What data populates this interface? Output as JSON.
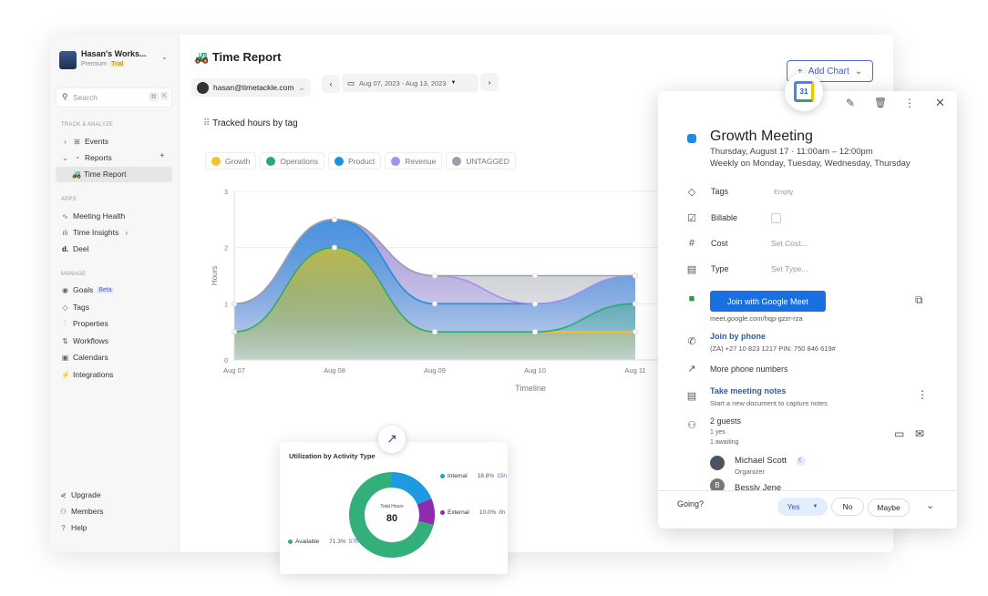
{
  "sidebar": {
    "workspace_name": "Hasan's Works...",
    "plan": "Premium",
    "plan_badge": "Trial",
    "search_placeholder": "Search",
    "shortcut": [
      "⌘",
      "K"
    ],
    "sections": {
      "track": "TRACK & ANALYZE",
      "apps": "APPS",
      "manage": "MANAGE"
    },
    "track_items": [
      {
        "label": "Events",
        "icon": "grid-icon"
      },
      {
        "label": "Reports",
        "icon": "pie-icon"
      },
      {
        "label": "Time Report",
        "icon": "tractor-icon"
      }
    ],
    "app_items": [
      {
        "label": "Meeting Health",
        "icon": "pulse-icon"
      },
      {
        "label": "Time Insights",
        "icon": "bar-icon"
      },
      {
        "label": "Deel",
        "icon": "deel-icon"
      }
    ],
    "manage_items": [
      {
        "label": "Goals",
        "badge": "Beta"
      },
      {
        "label": "Tags"
      },
      {
        "label": "Properties"
      },
      {
        "label": "Workflows"
      },
      {
        "label": "Calendars"
      },
      {
        "label": "Integrations"
      }
    ],
    "bottom_items": [
      {
        "label": "Upgrade"
      },
      {
        "label": "Members"
      },
      {
        "label": "Help"
      }
    ]
  },
  "header": {
    "title": "Time Report",
    "user": "hasan@timetackle.com",
    "date_range": "Aug 07, 2023 - Aug 13, 2023",
    "add_chart": "Add Chart"
  },
  "chart_data": [
    {
      "type": "area",
      "title": "Tracked hours by tag",
      "xlabel": "Timeline",
      "ylabel": "Hours",
      "stacked": true,
      "categories": [
        "Aug 07",
        "Aug 08",
        "Aug 09",
        "Aug 10",
        "Aug 11"
      ],
      "ylim": [
        0,
        3
      ],
      "yticks": [
        0,
        1,
        2,
        3
      ],
      "grid": true,
      "legend": "top",
      "series": [
        {
          "name": "Growth",
          "color": "#f5c12e",
          "values": [
            0.5,
            2,
            0.5,
            0.5,
            0.5
          ]
        },
        {
          "name": "Operations",
          "color": "#2aa876",
          "values": [
            0,
            0,
            0,
            0,
            0.5
          ]
        },
        {
          "name": "Product",
          "color": "#1e8fdc",
          "values": [
            0.5,
            0.5,
            0.5,
            0.5,
            0.5
          ]
        },
        {
          "name": "Revenue",
          "color": "#a58ff0",
          "values": [
            0,
            0,
            0.5,
            0,
            0
          ]
        },
        {
          "name": "UNTAGGED",
          "color": "#9aa0a8",
          "values": [
            0,
            0,
            0,
            0.5,
            0
          ]
        }
      ]
    },
    {
      "type": "pie",
      "title": "Utilization by Activity Type",
      "center_label": "Total Hours",
      "center_value": "80",
      "slices": [
        {
          "name": "Internal",
          "percent": "18.8%",
          "hours": "15h",
          "value": 18.8,
          "color": "#1e9be0"
        },
        {
          "name": "External",
          "percent": "10.0%",
          "hours": "8h",
          "value": 10.0,
          "color": "#8e2bb0"
        },
        {
          "name": "Available",
          "percent": "71.3%",
          "hours": "57h",
          "value": 71.3,
          "color": "#33b07a"
        }
      ]
    }
  ],
  "event": {
    "title": "Growth Meeting",
    "color": "#1a8ddb",
    "date": "Thursday, August 17",
    "time": "11:00am – 12:00pm",
    "recurrence": "Weekly on Monday, Tuesday, Wednesday, Thursday",
    "props": [
      {
        "label": "Tags",
        "value": "Empty"
      },
      {
        "label": "Billable",
        "value": ""
      },
      {
        "label": "Cost",
        "value": "Set Cost..."
      },
      {
        "label": "Type",
        "value": "Set Type..."
      }
    ],
    "meet_button": "Join with Google Meet",
    "meet_link": "meet.google.com/hqp-gzzr-rza",
    "phone_title": "Join by phone",
    "phone": "(ZA) +27 10 823 1217 PIN: 750 846 619#",
    "more_numbers": "More phone numbers",
    "notes_title": "Take meeting notes",
    "notes_sub": "Start a new document to capture notes",
    "guests": "2 guests",
    "guests_yes": "1 yes",
    "guests_awaiting": "1 awaiting",
    "guest_list": [
      {
        "name": "Michael Scott",
        "role": "Organizer",
        "initial": ""
      },
      {
        "name": "Bessly Jene",
        "role": "",
        "initial": "B"
      }
    ],
    "going": "Going?",
    "rsvp": [
      "Yes",
      "No",
      "Maybe"
    ],
    "calendar_day": "31"
  }
}
